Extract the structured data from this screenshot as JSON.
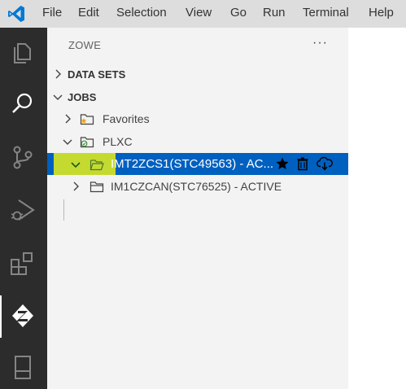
{
  "menu": [
    "File",
    "Edit",
    "Selection",
    "View",
    "Go",
    "Run",
    "Terminal",
    "Help"
  ],
  "activity_bar": {
    "items": [
      "explorer-icon",
      "search-icon",
      "source-control-icon",
      "run-debug-icon",
      "extensions-icon",
      "zowe-icon",
      "remote-icon"
    ],
    "active": "zowe-icon"
  },
  "sidebar": {
    "title": "ZOWE",
    "more_actions": "···",
    "sections": {
      "data_sets": "DATA SETS",
      "jobs": "JOBS"
    },
    "jobs_tree": {
      "favorites": "Favorites",
      "profile": "PLXC",
      "job_selected": "IMT2ZCS1(STC49563) - AC...",
      "job_other": "IM1CZCAN(STC76525) - ACTIVE"
    },
    "row_actions": [
      "star-icon",
      "trash-icon",
      "cloud-download-icon"
    ]
  },
  "colors": {
    "menubar": "#dddddd",
    "activity_bar": "#2c2c2c",
    "sidebar": "#f3f3f3",
    "selection": "#0060c0",
    "highlight": "#e8f016",
    "vscode_blue": "#0078d4"
  }
}
